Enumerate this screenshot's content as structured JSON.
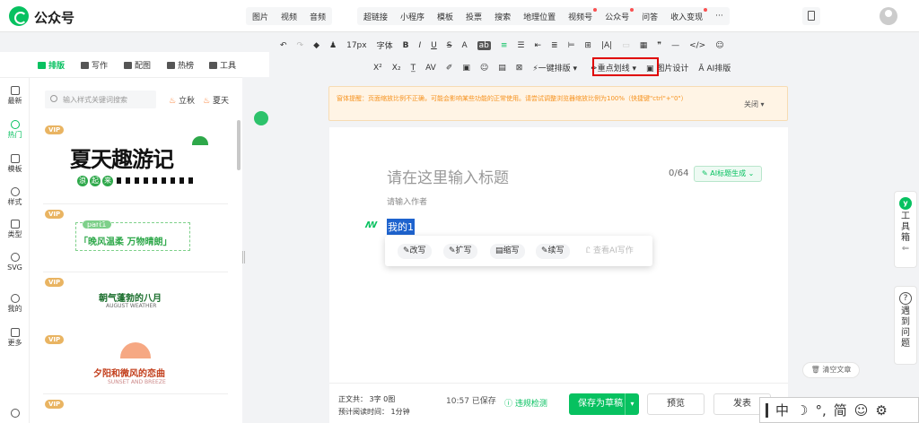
{
  "header": {
    "app_title": "公众号",
    "menu_group1": [
      "图片",
      "视频",
      "音频"
    ],
    "menu_group2": [
      {
        "label": "超链接",
        "dot": false
      },
      {
        "label": "小程序",
        "dot": false
      },
      {
        "label": "模板",
        "dot": false
      },
      {
        "label": "投票",
        "dot": false
      },
      {
        "label": "搜索",
        "dot": false
      },
      {
        "label": "地理位置",
        "dot": false
      },
      {
        "label": "视频号",
        "dot": true
      },
      {
        "label": "公众号",
        "dot": true
      },
      {
        "label": "问答",
        "dot": false
      },
      {
        "label": "收入变现",
        "dot": true
      },
      {
        "label": "···",
        "dot": false
      }
    ]
  },
  "left_tabs": [
    "排版",
    "写作",
    "配图",
    "热榜",
    "工具"
  ],
  "vnav": [
    "最新",
    "热门",
    "模板",
    "样式",
    "类型",
    "SVG",
    "我的",
    "更多"
  ],
  "search": {
    "placeholder": "输入样式关键词搜索",
    "chip1": "立秋",
    "chip2": "夏天"
  },
  "cards": {
    "vip_label": "VIP",
    "c1_title": "夏天趣游记",
    "c1_sub": [
      "浪",
      "起",
      "来"
    ],
    "c2_tag": "part1",
    "c2_title": "「晚风温柔 万物晴朗」",
    "c3_title": "朝气蓬勃的八月",
    "c3_sub": "AUGUST WEATHER",
    "c4_title": "夕阳和微风的恋曲",
    "c4_sub": "SUNSET AND BREEZE"
  },
  "toolbar": {
    "row1": [
      "↶",
      "↷",
      "◆",
      "♟",
      "17px",
      "字体",
      "B",
      "I",
      "U",
      "S",
      "A",
      "ab",
      "≡",
      "☰",
      "⇤",
      "≣",
      "⊨",
      "⊞",
      "|A|",
      "▭",
      "▦",
      "❞",
      "—",
      "</>",
      "☺"
    ],
    "row2": [
      "X²",
      "X₂",
      "T̲",
      "AV",
      "✐",
      "▣",
      "☺",
      "▤",
      "⊠"
    ],
    "one_key": "一键排版",
    "highlight": "重点划线",
    "image_design": "图片设计",
    "ai_layout": "AI排版"
  },
  "notice": {
    "text": "窗体提醒：页面缩放比例不正确，可能会影响某些功能的正常使用。请尝试调整浏览器缩放比例为100%（快捷键\"ctrl\"+\"0\"）",
    "close": "关闭"
  },
  "editor": {
    "title_placeholder": "请在这里输入标题",
    "title_count": "0/64",
    "ai_title": "AI标题生成",
    "author_placeholder": "请输入作者",
    "selected_text": "我的1",
    "popup": [
      "改写",
      "扩写",
      "缩写",
      "续写",
      "查看AI写作"
    ]
  },
  "footer": {
    "word_count": "正文共：  3字 0图",
    "read_time": "预计阅读时间：  1分钟",
    "saved": "10:57  已保存",
    "violation": "违规检测",
    "save_draft": "保存为草稿",
    "preview": "预览",
    "publish": "发表",
    "clear": "清空文章"
  },
  "side": {
    "toolbox": [
      "工",
      "具",
      "箱"
    ],
    "help": [
      "遇",
      "到",
      "问",
      "题"
    ]
  },
  "ime": [
    "中",
    "☽",
    "°,",
    "简",
    "☺",
    "⚙"
  ]
}
